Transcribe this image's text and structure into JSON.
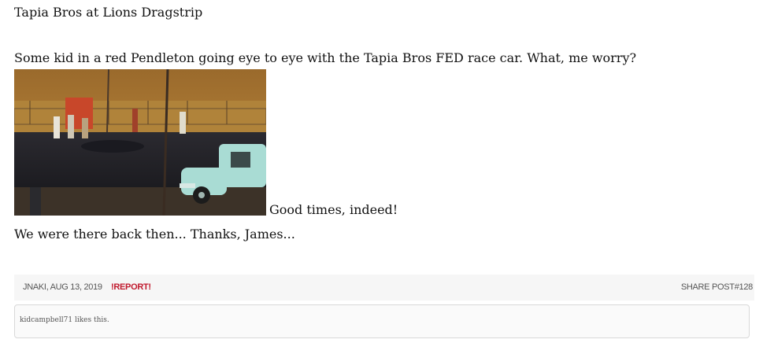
{
  "post": {
    "title": "Tapia Bros at Lions Dragstrip",
    "body_line1": "Some kid in a red Pendleton going eye to eye with the Tapia Bros FED race car. What, me worry?",
    "caption": "Good times, indeed!",
    "body_line2": "We were there back then... Thanks, James..."
  },
  "footer": {
    "author": "JNAKI",
    "separator": ",",
    "date": "AUG 13, 2019",
    "report_label": "!REPORT!",
    "share_label": "SHARE POST#128"
  },
  "likes": {
    "user": "kidcampbell71",
    "text": "likes this."
  }
}
